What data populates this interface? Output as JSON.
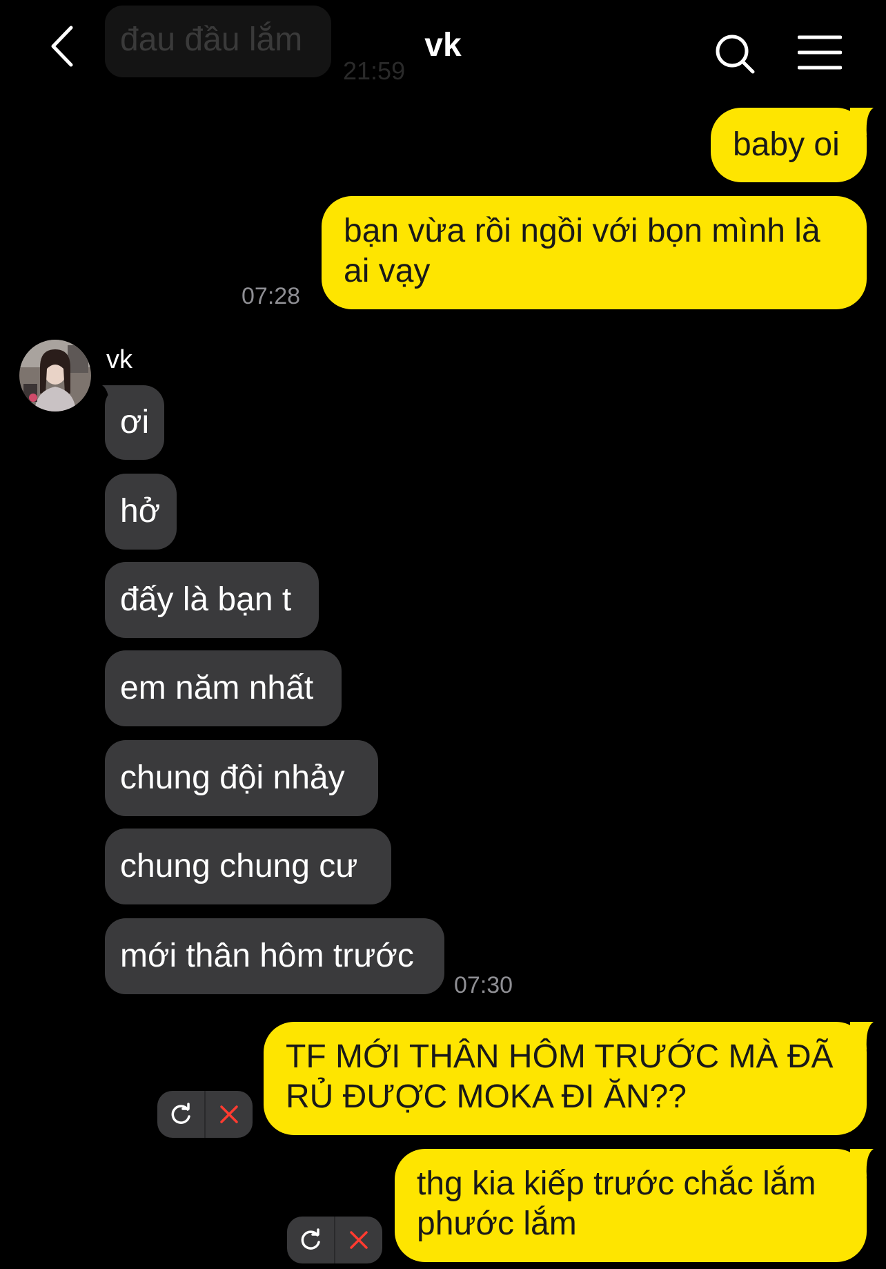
{
  "previous_message": {
    "text": "đau đầu lắm",
    "time": "21:59"
  },
  "header": {
    "title": "vk",
    "back_icon": "chevron-left-icon",
    "search_icon": "search-icon",
    "menu_icon": "hamburger-menu-icon"
  },
  "colors": {
    "my_bubble": "#FEE500",
    "their_bubble": "#3a3a3c",
    "background": "#000000",
    "timestamp": "#8e8e93",
    "cancel_x": "#ff3b30"
  },
  "messages": {
    "m1": {
      "text": "baby oi"
    },
    "m2": {
      "lines": [
        "bạn vừa rồi ngồi với bọn mình là",
        "ai vạy"
      ],
      "time": "07:28"
    },
    "sender": {
      "name": "vk",
      "avatar": "avatar-photo"
    },
    "r1": {
      "text": "ơi"
    },
    "r2": {
      "text": "hở"
    },
    "r3": {
      "text": "đấy là bạn t"
    },
    "r4": {
      "text": "em năm nhất"
    },
    "r5": {
      "text": "chung đội nhảy"
    },
    "r6": {
      "text": "chung chung cư"
    },
    "r7": {
      "text": "mới thân hôm trước",
      "time": "07:30"
    },
    "m3": {
      "lines": [
        "TF MỚI THÂN HÔM TRƯỚC MÀ ĐÃ",
        "RỦ ĐƯỢC MOKA ĐI ĂN??"
      ],
      "status": "failed"
    },
    "m4": {
      "lines": [
        "thg kia kiếp trước chắc lắm",
        "phước lắm"
      ],
      "status": "failed"
    }
  }
}
